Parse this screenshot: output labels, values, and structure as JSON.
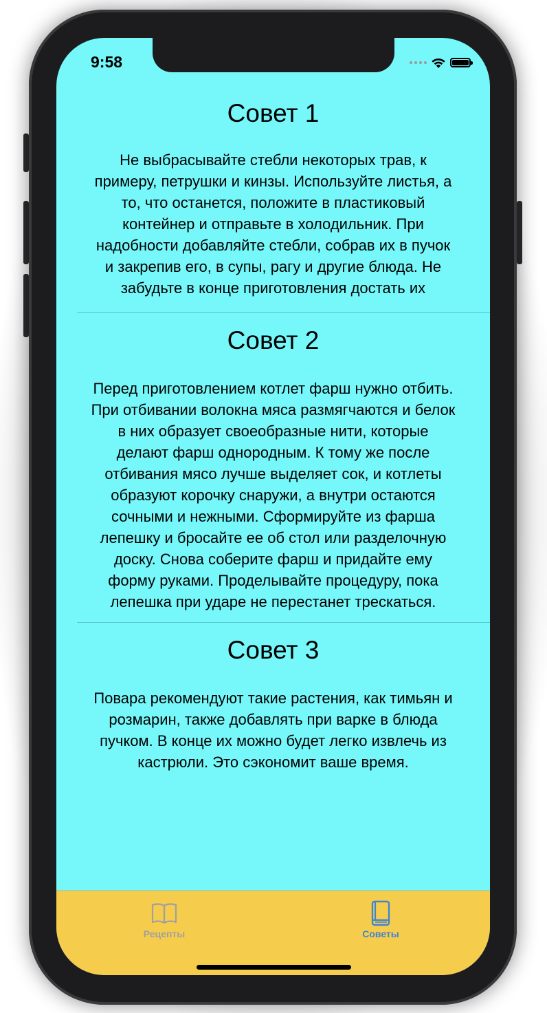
{
  "status_bar": {
    "time": "9:58"
  },
  "tips": [
    {
      "title": "Совет 1",
      "body": "Не выбрасывайте стебли некоторых трав, к примеру, петрушки и кинзы. Используйте листья, а то, что останется, положите в пластиковый контейнер и отправьте в холодильник. При надобности добавляйте стебли, собрав их в пучок и закрепив его, в супы, рагу и другие блюда. Не забудьте в конце приготовления достать их"
    },
    {
      "title": "Совет 2",
      "body": "Перед приготовлением котлет фарш нужно отбить. При отбивании волокна мяса размягчаются и белок в них образует своеобразные нити, которые делают фарш однородным. К тому же после отбивания мясо лучше выделяет сок, и котлеты образуют корочку снаружи, а внутри остаются сочными и нежными. Сформируйте из фарша лепешку и бросайте ее об стол или разделочную доску. Снова соберите фарш и придайте ему форму руками. Проделывайте процедуру, пока лепешка при ударе не перестанет трескаться."
    },
    {
      "title": "Совет 3",
      "body": "Повара рекомендуют такие растения, как тимьян и розмарин, также добавлять при варке в блюда пучком. В конце их можно будет легко извлечь из кастрюли. Это сэкономит ваше время."
    }
  ],
  "tab_bar": {
    "tabs": [
      {
        "label": "Рецепты",
        "icon": "open-book-icon",
        "selected": false
      },
      {
        "label": "Советы",
        "icon": "closed-book-icon",
        "selected": true
      }
    ]
  },
  "colors": {
    "content_background": "#76f8fb",
    "tab_bar_background": "#f6cc4c",
    "tab_selected": "#3f85d1",
    "tab_unselected": "#a0a0a0"
  }
}
